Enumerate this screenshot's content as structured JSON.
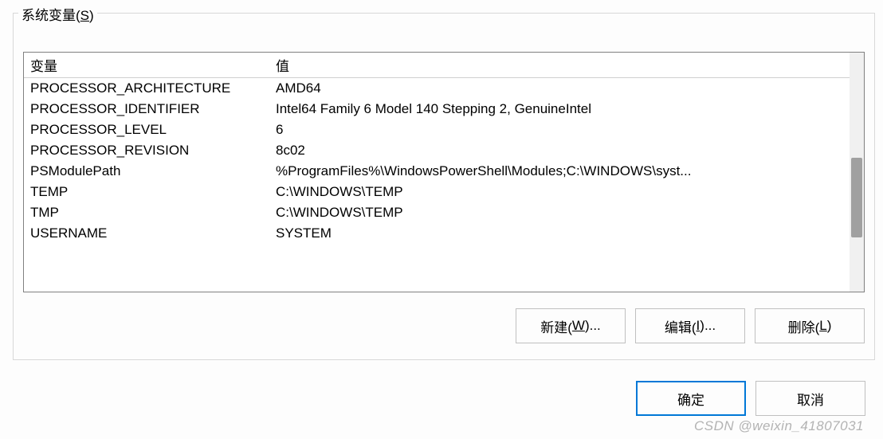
{
  "groupbox": {
    "label_prefix": "系统变量(",
    "label_hotkey": "S",
    "label_suffix": ")"
  },
  "table": {
    "headers": {
      "variable": "变量",
      "value": "值"
    },
    "rows": [
      {
        "variable": "PROCESSOR_ARCHITECTURE",
        "value": "AMD64"
      },
      {
        "variable": "PROCESSOR_IDENTIFIER",
        "value": "Intel64 Family 6 Model 140 Stepping 2, GenuineIntel"
      },
      {
        "variable": "PROCESSOR_LEVEL",
        "value": "6"
      },
      {
        "variable": "PROCESSOR_REVISION",
        "value": "8c02"
      },
      {
        "variable": "PSModulePath",
        "value": "%ProgramFiles%\\WindowsPowerShell\\Modules;C:\\WINDOWS\\syst..."
      },
      {
        "variable": "TEMP",
        "value": "C:\\WINDOWS\\TEMP"
      },
      {
        "variable": "TMP",
        "value": "C:\\WINDOWS\\TEMP"
      },
      {
        "variable": "USERNAME",
        "value": "SYSTEM"
      }
    ]
  },
  "buttons": {
    "new_prefix": "新建(",
    "new_hotkey": "W",
    "new_suffix": ")...",
    "edit_prefix": "编辑(",
    "edit_hotkey": "I",
    "edit_suffix": ")...",
    "delete_prefix": "删除(",
    "delete_hotkey": "L",
    "delete_suffix": ")",
    "ok": "确定",
    "cancel": "取消"
  },
  "watermark": "CSDN @weixin_41807031"
}
